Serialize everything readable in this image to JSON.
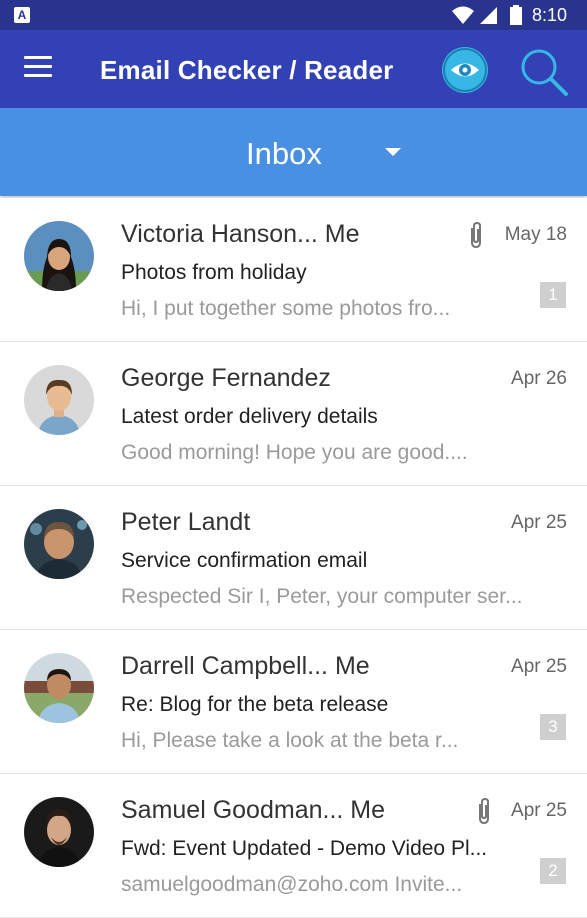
{
  "status_bar": {
    "time": "8:10",
    "notification_letter": "A"
  },
  "app_bar": {
    "title": "Email Checker / Reader",
    "menu_icon": "hamburger-menu-icon",
    "eye_icon": "eye-icon",
    "search_icon": "search-icon",
    "accent_color": "#3242b4"
  },
  "folder": {
    "selected": "Inbox",
    "bar_color": "#4a90e2"
  },
  "emails": [
    {
      "sender": "Victoria Hanson... Me",
      "subject": "Photos from holiday",
      "preview": "Hi,  I put together some photos fro...",
      "date": "May 18",
      "has_attachment": true,
      "thread_count": "1"
    },
    {
      "sender": "George Fernandez",
      "subject": "Latest order delivery details",
      "preview": "Good morning!     Hope you are good....",
      "date": "Apr 26",
      "has_attachment": false,
      "thread_count": ""
    },
    {
      "sender": "Peter Landt",
      "subject": "Service confirmation email",
      "preview": "Respected Sir   I, Peter, your computer ser...",
      "date": "Apr 25",
      "has_attachment": false,
      "thread_count": ""
    },
    {
      "sender": "Darrell Campbell... Me",
      "subject": "Re: Blog for the beta release",
      "preview": "Hi,     Please take a look at the beta r...",
      "date": "Apr 25",
      "has_attachment": false,
      "thread_count": "3"
    },
    {
      "sender": "Samuel Goodman... Me",
      "subject": "Fwd: Event Updated - Demo Video Pl...",
      "preview": "samuelgoodman@zoho.com Invite...",
      "date": "Apr 25",
      "has_attachment": true,
      "thread_count": "2"
    }
  ]
}
